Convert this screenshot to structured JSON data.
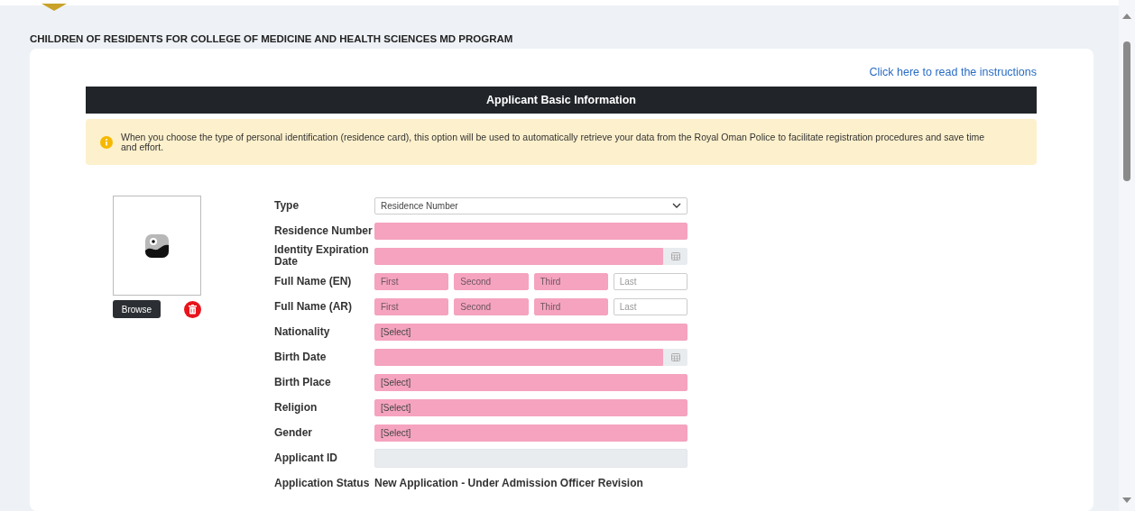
{
  "page_title": "CHILDREN OF RESIDENTS FOR COLLEGE OF MEDICINE AND HEALTH SCIENCES MD PROGRAM",
  "instructions_link": "Click here to read the instructions",
  "section_title": "Applicant Basic Information",
  "notice": "When you choose the type of personal identification (residence card), this option will be used to automatically retrieve your data from the Royal Oman Police to facilitate registration procedures and save time and effort.",
  "photo": {
    "browse_button": "Browse"
  },
  "fields": [
    {
      "label": "Type",
      "kind": "dropdown",
      "value": "Residence Number",
      "required": false
    },
    {
      "label": "Residence Number",
      "kind": "text",
      "required": true
    },
    {
      "label": "Identity Expiration Date",
      "kind": "date",
      "required": true
    },
    {
      "label": "Full Name (EN)",
      "kind": "name",
      "parts": [
        {
          "placeholder": "First",
          "required": true
        },
        {
          "placeholder": "Second",
          "required": true
        },
        {
          "placeholder": "Third",
          "required": true
        },
        {
          "placeholder": "Last",
          "required": false
        }
      ]
    },
    {
      "label": "Full Name (AR)",
      "kind": "name",
      "parts": [
        {
          "placeholder": "First",
          "required": true
        },
        {
          "placeholder": "Second",
          "required": true
        },
        {
          "placeholder": "Third",
          "required": true
        },
        {
          "placeholder": "Last",
          "required": false
        }
      ]
    },
    {
      "label": "Nationality",
      "kind": "select",
      "value": "[Select]",
      "required": true
    },
    {
      "label": "Birth Date",
      "kind": "date",
      "required": true
    },
    {
      "label": "Birth Place",
      "kind": "select",
      "value": "[Select]",
      "required": true
    },
    {
      "label": "Religion",
      "kind": "select",
      "value": "[Select]",
      "required": true
    },
    {
      "label": "Gender",
      "kind": "select",
      "value": "[Select]",
      "required": true
    },
    {
      "label": "Applicant ID",
      "kind": "readonly"
    },
    {
      "label": "Application Status",
      "kind": "status",
      "value": "New Application - Under Admission Officer Revision"
    }
  ]
}
